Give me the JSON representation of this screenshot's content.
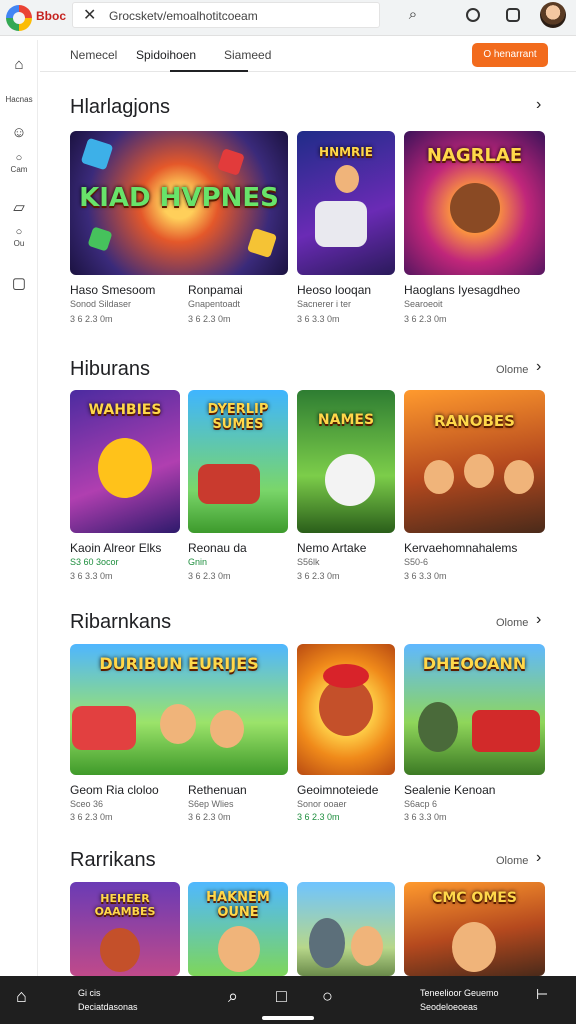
{
  "topbar": {
    "brand": "Bboc",
    "search_text": "Grocsketv/emoalhotitcoeam",
    "icons": [
      "google-logo",
      "close-icon",
      "search-icon",
      "clock-icon",
      "box-icon",
      "avatar"
    ]
  },
  "sidebar": {
    "items": [
      {
        "icon": "home-icon",
        "label": ""
      },
      {
        "icon": "",
        "label": "Hacnas"
      },
      {
        "icon": "smile-icon",
        "label": ""
      },
      {
        "icon": "circle-icon",
        "label": "Cam"
      },
      {
        "icon": "note-icon",
        "label": ""
      },
      {
        "icon": "person-icon",
        "label": "Ou"
      },
      {
        "icon": "square-icon",
        "label": ""
      }
    ]
  },
  "tabs": [
    "Nemecel",
    "Spidoihoen",
    "Siameed"
  ],
  "cta_label": "O henarrant",
  "sections": [
    {
      "title": "Hlarlagjons",
      "more": "",
      "cards": [
        {
          "art": "KIAD HVPNES",
          "title": "Haso Smesoom",
          "sub": "Sonod Sildaser",
          "info": "3 6 2.3 0m"
        },
        {
          "art": "HNMRIE",
          "title": "Ronpamai",
          "sub": "Gnapentoadt",
          "info": "3 6 2.3 0m"
        },
        {
          "art": "",
          "title": "Heoso looqan",
          "sub": "Sacnerer i ter",
          "info": "3 6 3.3 0m"
        },
        {
          "art": "NAGRLAE",
          "title": "Haoglans Iyesagdheo",
          "sub": "Searoeoit",
          "info": "3 6 2.3 0m"
        }
      ]
    },
    {
      "title": "Hiburans",
      "more": "Olome",
      "cards": [
        {
          "art": "WAHBIES",
          "title": "Kaoin Alreor Elks",
          "sub": "S3 60 3ocor",
          "info": "3 6 3.3 0m"
        },
        {
          "art": "DYERLIP SUMES",
          "title": "Reonau da",
          "sub": "Gnin",
          "info": "3 6 2.3 0m"
        },
        {
          "art": "NAMES",
          "title": "Nemo Artake",
          "sub": "S56lk",
          "info": "3 6 2.3 0m"
        },
        {
          "art": "RANOBES",
          "title": "Kervaehomnahalems",
          "sub": "S50-6",
          "info": "3 6 3.3 0m"
        }
      ]
    },
    {
      "title": "Ribarnkans",
      "more": "Olome",
      "cards": [
        {
          "art": "DURIBUN EURIJES",
          "title": "Geom Ria cloloo",
          "sub": "Sceo 36",
          "info": "3 6 2.3 0m"
        },
        {
          "art": "",
          "title": "Rethenuan",
          "sub": "S6ep Wlies",
          "info": "3 6 2.3 0m"
        },
        {
          "art": "",
          "title": "Geoimnoteiede",
          "sub": "Sonor ooaer",
          "info": "3 6 2.3 0m"
        },
        {
          "art": "DHEOOANN",
          "title": "Sealenie Kenoan",
          "sub": "S6acp 6",
          "info": "3 6 3.3 0m"
        }
      ]
    },
    {
      "title": "Rarrikans",
      "more": "Olome",
      "cards": [
        {
          "art": "HEHEER OAAMBES",
          "title": "",
          "sub": "",
          "info": ""
        },
        {
          "art": "HAKNEM OUNE",
          "title": "",
          "sub": "",
          "info": ""
        },
        {
          "art": "",
          "title": "",
          "sub": "",
          "info": ""
        },
        {
          "art": "CMC OMES",
          "title": "",
          "sub": "",
          "info": ""
        }
      ]
    }
  ],
  "bottombar": {
    "left_line1": "Gi cis",
    "left_line2": "Deciatdasonas",
    "right_line1": "Teneelioor Geuemo",
    "right_line2": "Seodeloeoeas"
  },
  "colors": {
    "accent": "#f26b1d",
    "topbar_bg": "#f1f3f4",
    "bottombar_bg": "#1f1f1f",
    "green": "#1e8e3e"
  }
}
